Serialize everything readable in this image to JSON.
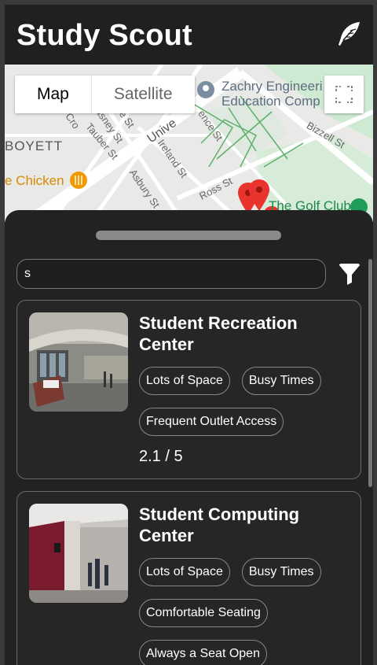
{
  "header": {
    "title": "Study Scout",
    "icon": "quill-icon"
  },
  "map": {
    "toggle": {
      "map_label": "Map",
      "satellite_label": "Satellite"
    },
    "labels": {
      "engineering": "Zachry Engineeri",
      "engineering2": "Education Comp",
      "boyett": "BOYETT",
      "chicken": "e Chicken",
      "golf": "The Golf Club",
      "univ": "Unive",
      "bizzell": "Bizzell St",
      "ross": "Ross St",
      "ireland": "Ireland St",
      "asbury": "Asbury St",
      "tauber": "Tauber St",
      "ence": "ence St",
      "cro": "Cro",
      "asney": "asney St",
      "es": "e St"
    }
  },
  "sheet": {
    "search": {
      "value": "s"
    },
    "cards": [
      {
        "title": "Student Recreation Center",
        "tags": [
          "Lots of Space",
          "Busy Times",
          "Frequent Outlet Access"
        ],
        "rating": "2.1 / 5"
      },
      {
        "title": "Student Computing Center",
        "tags": [
          "Lots of Space",
          "Busy Times",
          "Comfortable Seating",
          "Always a Seat Open"
        ]
      }
    ]
  }
}
